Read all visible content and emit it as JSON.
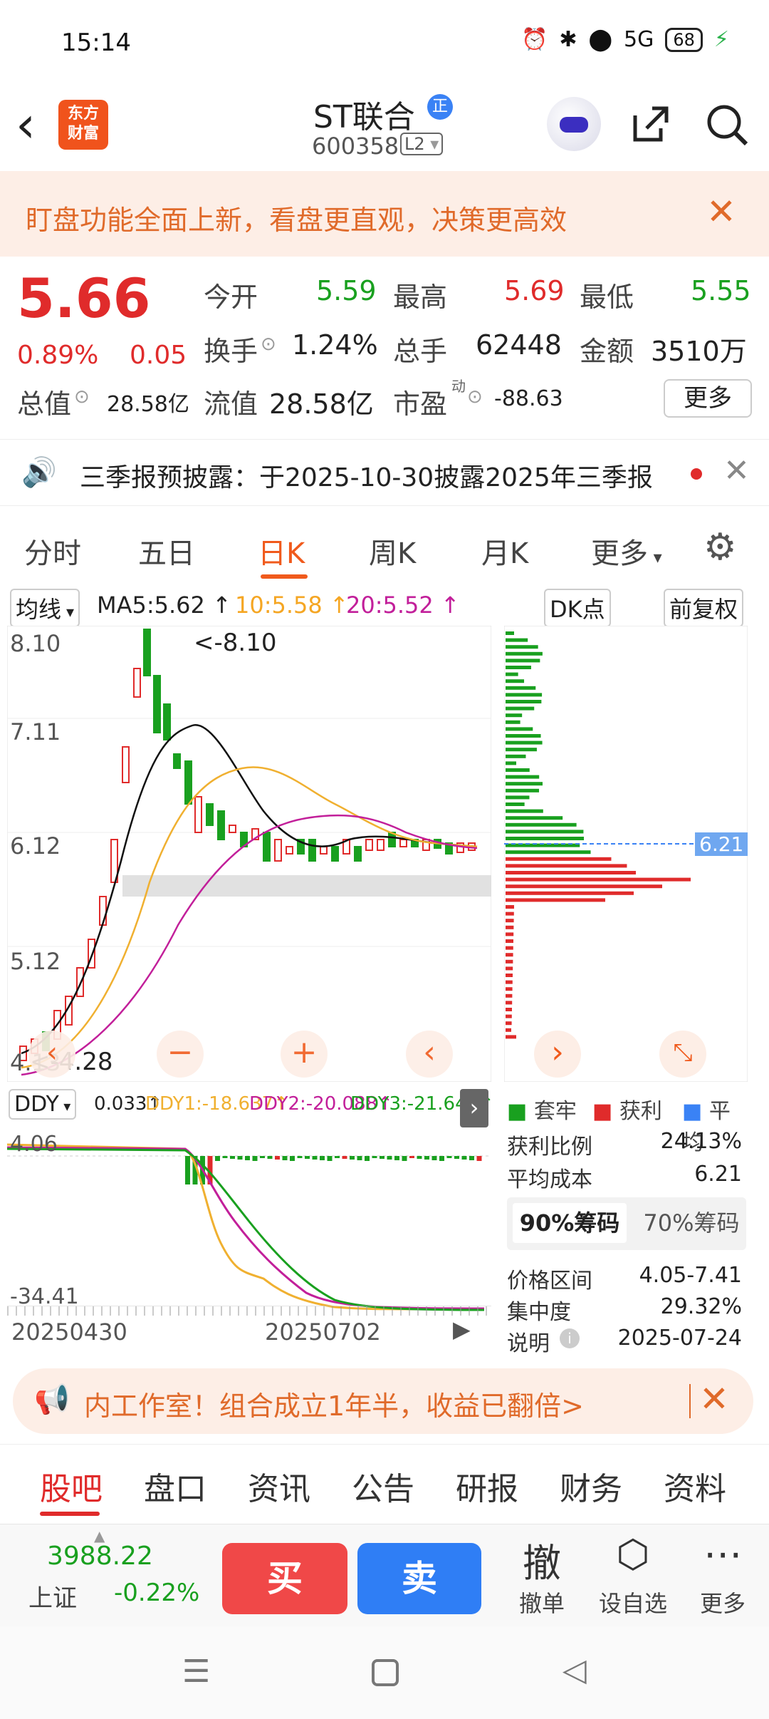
{
  "status_bar": {
    "time": "15:14",
    "battery": "68",
    "network": "5G"
  },
  "header": {
    "name": "ST联合",
    "badge": "正",
    "code": "600358",
    "level": "L2",
    "logo_line1": "东方",
    "logo_line2": "财富"
  },
  "banner": {
    "text": "盯盘功能全面上新，看盘更直观，决策更高效"
  },
  "quote": {
    "price": "5.66",
    "pct": "0.89%",
    "change": "0.05",
    "open_label": "今开",
    "open": "5.59",
    "high_label": "最高",
    "high": "5.69",
    "low_label": "最低",
    "low": "5.55",
    "turnover_label": "换手",
    "turnover": "1.24%",
    "volume_label": "总手",
    "volume": "62448",
    "amount_label": "金额",
    "amount": "3510万",
    "total_cap_label": "总值",
    "total_cap": "28.58亿",
    "float_cap_label": "流值",
    "float_cap": "28.58亿",
    "pe_label": "市盈",
    "pe_sup": "动",
    "pe": "-88.63",
    "more": "更多"
  },
  "notice": {
    "text": "三季报预披露：于2025-10-30披露2025年三季报"
  },
  "chart_tabs": [
    "分时",
    "五日",
    "日K",
    "周K",
    "月K",
    "更多"
  ],
  "ma_row": {
    "selector": "均线",
    "ma5": "MA5:5.62",
    "ma10": "10:5.58",
    "ma20": "20:5.52",
    "dk": "DK点",
    "adjust": "前复权"
  },
  "kline": {
    "y_labels": [
      "8.10",
      "7.11",
      "6.12",
      "5.12",
      "4.13"
    ],
    "max_marker": "<-8.10",
    "min_marker": "<-4.28",
    "dist_price": "6.21"
  },
  "ddy": {
    "selector": "DDY",
    "val": "0.033",
    "ddy1": "DDY1:-18.637",
    "ddy2": "DDY2:-20.088",
    "ddy3": "DDY3:-21.647",
    "y_top": "4.06",
    "y_bottom": "-34.41",
    "date_start": "20250430",
    "date_mid": "20250702"
  },
  "dist_info": {
    "legend_trapped": "套牢",
    "legend_profit": "获利",
    "legend_avg": "平均",
    "profit_ratio_label": "获利比例",
    "profit_ratio": "24.13%",
    "avg_cost_label": "平均成本",
    "avg_cost": "6.21",
    "chip90": "90%筹码",
    "chip70": "70%筹码",
    "price_range_label": "价格区间",
    "price_range": "4.05-7.41",
    "concentration_label": "集中度",
    "concentration": "29.32%",
    "desc_label": "说明",
    "date": "2025-07-24"
  },
  "promo": {
    "text": "内工作室！组合成立1年半，收益已翻倍>"
  },
  "bottom_tabs": [
    "股吧",
    "盘口",
    "资讯",
    "公告",
    "研报",
    "财务",
    "资料"
  ],
  "trade": {
    "index_value": "3988.22",
    "index_name": "上证",
    "index_change": "-0.22%",
    "buy": "买",
    "sell": "卖",
    "cancel_icon": "撤",
    "cancel": "撤单",
    "watch": "设自选",
    "more": "更多"
  },
  "colors": {
    "up": "#e02b2b",
    "down": "#19a01f",
    "accent": "#f05a1c",
    "buy": "#f04848",
    "sell": "#2f7ef5"
  }
}
